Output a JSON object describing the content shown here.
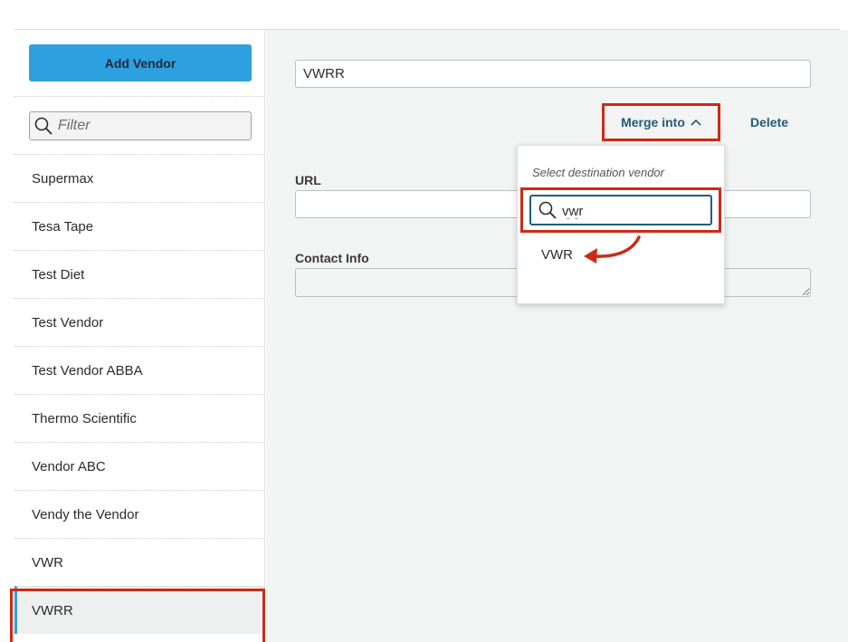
{
  "sidebar": {
    "add_button_label": "Add Vendor",
    "filter_placeholder": "Filter",
    "items": [
      {
        "label": "Supermax"
      },
      {
        "label": "Tesa Tape"
      },
      {
        "label": "Test Diet"
      },
      {
        "label": "Test Vendor"
      },
      {
        "label": "Test Vendor ABBA"
      },
      {
        "label": "Thermo Scientific"
      },
      {
        "label": "Vendor ABC"
      },
      {
        "label": "Vendy the Vendor"
      },
      {
        "label": "VWR"
      },
      {
        "label": "VWRR",
        "selected": true
      }
    ]
  },
  "main": {
    "name_value": "VWRR",
    "merge_label": "Merge into",
    "delete_label": "Delete",
    "url_label": "URL",
    "url_value": "",
    "contact_label": "Contact Info",
    "contact_value": ""
  },
  "dropdown": {
    "title": "Select destination vendor",
    "search_value": "vwr",
    "options": [
      "VWR"
    ]
  },
  "colors": {
    "accent": "#2e9fdf",
    "link": "#1f5c7a",
    "highlight": "#cc2a16",
    "panel_bg": "#f2f3f3"
  },
  "icons": {
    "filter": "search-icon",
    "merge": "chevron-up-icon",
    "dropdown_search": "search-icon",
    "annotation": "curved-arrow-icon"
  }
}
